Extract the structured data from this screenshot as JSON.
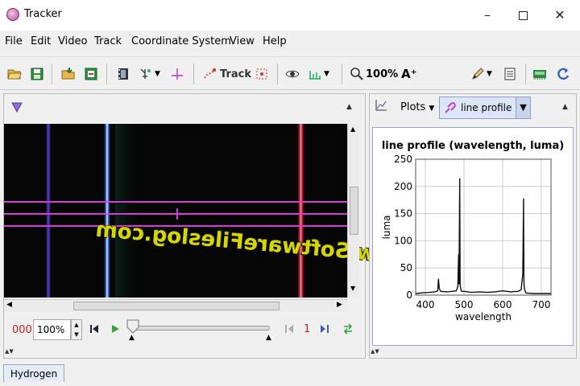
{
  "window": {
    "title": "Tracker",
    "minimize": "–",
    "maximize": "☐",
    "close": "✕"
  },
  "menu": [
    "File",
    "Edit",
    "Video",
    "Track",
    "Coordinate System",
    "View",
    "Help"
  ],
  "toolbar": {
    "track_label": "Track",
    "zoom_label": "100%",
    "font_label": "A⁺"
  },
  "video": {
    "watermark": "www.SoftwareFileslog.com"
  },
  "player": {
    "frame_counter": "000",
    "rate": "100%",
    "step_size": "1"
  },
  "plot_panel": {
    "plots_label": "Plots",
    "track_select": "line profile"
  },
  "chart_data": {
    "type": "line",
    "title": "line profile (wavelength, luma)",
    "xlabel": "wavelength",
    "ylabel": "luma",
    "xlim": [
      375,
      725
    ],
    "ylim": [
      0,
      250
    ],
    "xticks": [
      400,
      500,
      600,
      700
    ],
    "yticks": [
      0,
      50,
      100,
      150,
      200,
      250
    ],
    "grid": true,
    "series": [
      {
        "x": [
          375,
          390,
          410,
          425,
          432,
          434,
          436,
          440,
          455,
          470,
          480,
          484,
          486,
          487,
          489,
          490,
          492,
          494,
          500,
          520,
          540,
          560,
          580,
          600,
          620,
          640,
          648,
          652,
          654,
          655,
          656,
          658,
          660,
          680,
          700,
          725
        ],
        "values": [
          3,
          4,
          5,
          6,
          8,
          30,
          12,
          7,
          6,
          7,
          8,
          15,
          75,
          20,
          215,
          18,
          10,
          7,
          7,
          5,
          6,
          5,
          6,
          8,
          6,
          7,
          10,
          40,
          178,
          25,
          12,
          8,
          4,
          3,
          3,
          3
        ]
      }
    ]
  },
  "tabs": {
    "video_tab": "Hydrogen"
  }
}
